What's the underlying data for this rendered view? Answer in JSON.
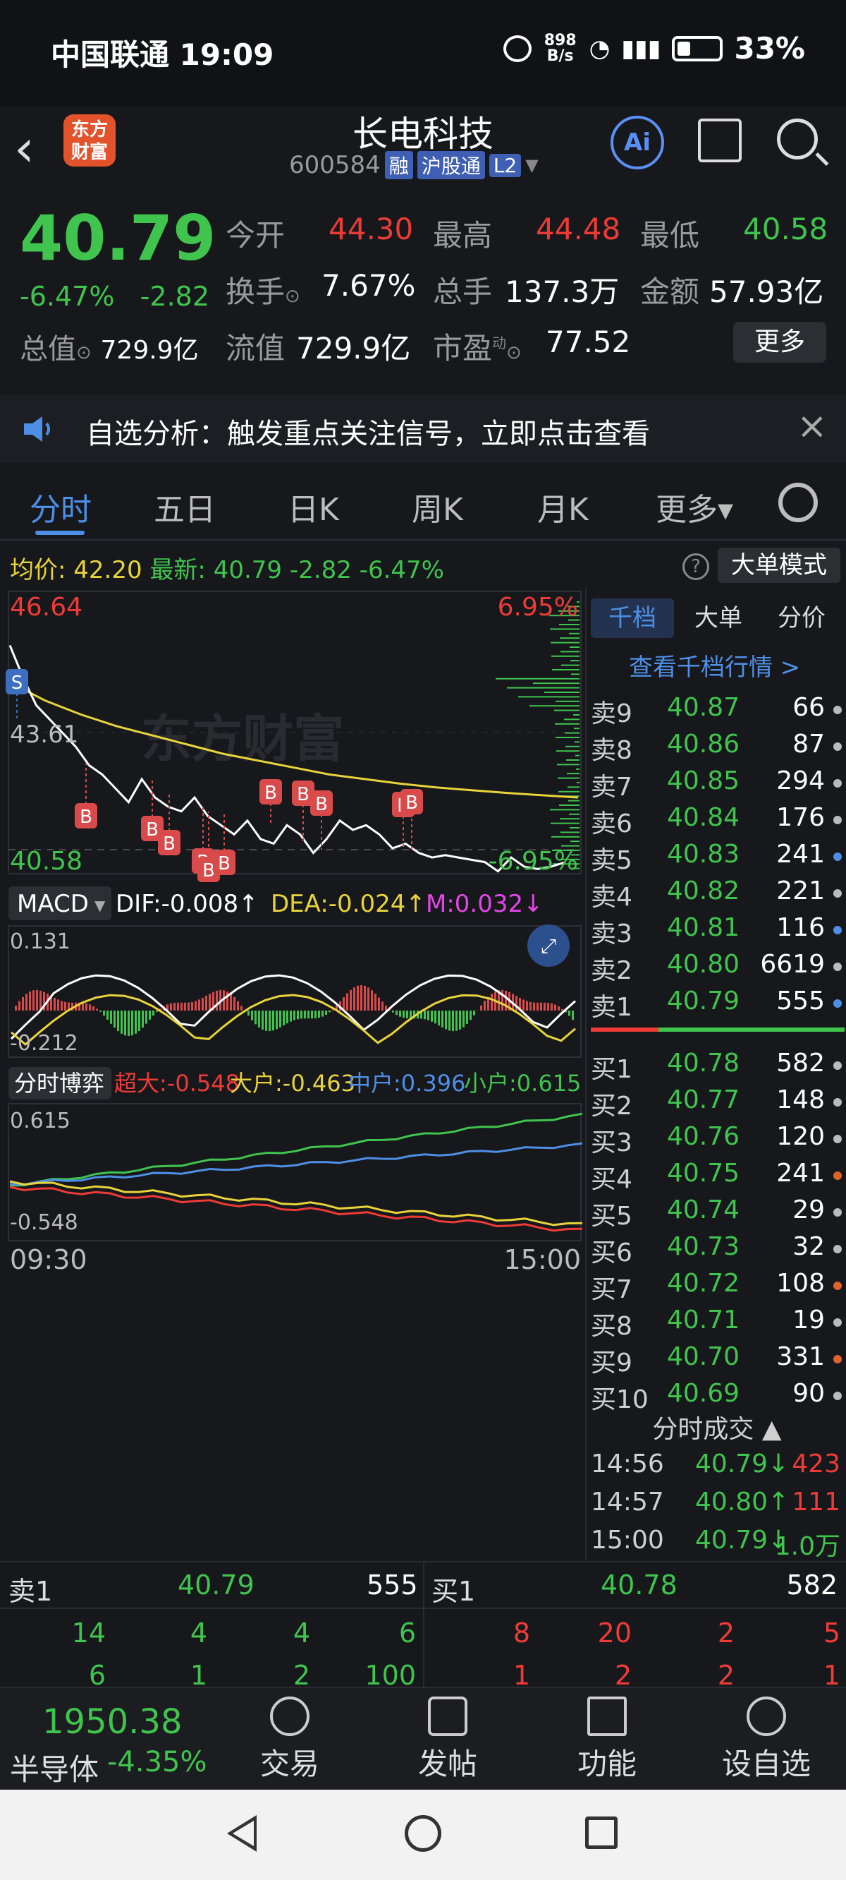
{
  "status_bar": {
    "carrier_time": "中国联通 19:09",
    "net_speed": "898 B/s",
    "battery": "33%"
  },
  "header": {
    "stock_name": "长电科技",
    "code": "600584",
    "tag_margin": "融",
    "tag_hk": "沪股通",
    "tag_level": "L2",
    "logo_text": "东方财富",
    "ai_label": "Ai"
  },
  "quote": {
    "price": "40.79",
    "change_pct": "-6.47%",
    "change": "-2.82",
    "open_label": "今开",
    "open": "44.30",
    "high_label": "最高",
    "high": "44.48",
    "low_label": "最低",
    "low": "40.58",
    "turnover_label": "换手",
    "turnover": "7.67%",
    "volume_label": "总手",
    "volume": "137.3万",
    "amount_label": "金额",
    "amount": "57.93亿",
    "mktcap_label": "总值",
    "mktcap": "729.9亿",
    "float_label": "流值",
    "float": "729.9亿",
    "pe_label": "市盈",
    "pe_sup": "动",
    "pe": "77.52",
    "more_label": "更多"
  },
  "alert": {
    "text": "自选分析：触发重点关注信号，立即点击查看"
  },
  "tabs": [
    "分时",
    "五日",
    "日K",
    "周K",
    "月K",
    "更多▾"
  ],
  "chart_head": {
    "avg_label": "均价:",
    "avg": "42.20",
    "latest_label": "最新:",
    "latest": "40.79",
    "chg": "-2.82",
    "chg_pct": "-6.47%",
    "help": "?",
    "big_mode": "大单模式"
  },
  "chart_data": [
    {
      "type": "line",
      "title": "分时",
      "ylim": [
        40.58,
        46.64
      ],
      "y_labels": {
        "top": "46.64",
        "top_pct": "6.95%",
        "bottom": "40.58",
        "bottom_pct": "-6.95%",
        "prev_close": "43.61"
      },
      "x_labels": [
        "09:30",
        "15:00"
      ],
      "series": [
        {
          "name": "最新",
          "values": [
            45.5,
            44.8,
            44.2,
            43.9,
            43.6,
            43.3,
            42.9,
            42.7,
            42.4,
            42.1,
            42.6,
            42.2,
            42.0,
            41.9,
            42.2,
            41.8,
            41.6,
            41.4,
            41.7,
            41.3,
            41.2,
            41.6,
            41.4,
            41.0,
            41.3,
            41.7,
            41.5,
            41.6,
            41.4,
            41.1,
            41.2,
            41.0,
            40.9,
            40.95,
            40.9,
            40.85,
            40.8,
            40.6,
            40.9,
            40.7,
            40.65,
            40.7,
            40.79
          ]
        },
        {
          "name": "均价",
          "values": [
            44.7,
            44.3,
            44.0,
            43.75,
            43.55,
            43.35,
            43.15,
            43.0,
            42.85,
            42.7,
            42.6,
            42.5,
            42.42,
            42.36,
            42.3,
            42.25,
            42.2
          ]
        }
      ],
      "markers": {
        "S": 1,
        "B": 13
      }
    },
    {
      "type": "bar",
      "title": "MACD",
      "dif": "DIF:-0.008↑",
      "dea": "DEA:-0.024↑",
      "m": "M:0.032↓",
      "ylim": [
        -0.212,
        0.131
      ],
      "y_labels": {
        "top": "0.131",
        "bottom": "-0.212"
      }
    },
    {
      "type": "line",
      "title": "分时博弈",
      "ylim": [
        -0.548,
        0.615
      ],
      "y_labels": {
        "top": "0.615",
        "bottom": "-0.548"
      },
      "series": [
        {
          "name": "超大",
          "value": "-0.548"
        },
        {
          "name": "大户",
          "value": "-0.463"
        },
        {
          "name": "中户",
          "value": "0.396"
        },
        {
          "name": "小户",
          "value": "0.615"
        }
      ]
    }
  ],
  "book": {
    "tabs": [
      "千档",
      "大单",
      "分价"
    ],
    "link": "查看千档行情 >",
    "asks": [
      {
        "label": "卖9",
        "price": "40.87",
        "vol": "66",
        "dot": "#bbbbbb"
      },
      {
        "label": "卖8",
        "price": "40.86",
        "vol": "87",
        "dot": "#bbbbbb"
      },
      {
        "label": "卖7",
        "price": "40.85",
        "vol": "294",
        "dot": "#bbbbbb"
      },
      {
        "label": "卖6",
        "price": "40.84",
        "vol": "176",
        "dot": "#bbbbbb"
      },
      {
        "label": "卖5",
        "price": "40.83",
        "vol": "241",
        "dot": "#4d8fe6"
      },
      {
        "label": "卖4",
        "price": "40.82",
        "vol": "221",
        "dot": "#bbbbbb"
      },
      {
        "label": "卖3",
        "price": "40.81",
        "vol": "116",
        "dot": "#4d8fe6"
      },
      {
        "label": "卖2",
        "price": "40.80",
        "vol": "6619",
        "dot": "#bbbbbb"
      },
      {
        "label": "卖1",
        "price": "40.79",
        "vol": "555",
        "dot": "#4d8fe6"
      }
    ],
    "bids": [
      {
        "label": "买1",
        "price": "40.78",
        "vol": "582",
        "dot": "#bbbbbb"
      },
      {
        "label": "买2",
        "price": "40.77",
        "vol": "148",
        "dot": "#bbbbbb"
      },
      {
        "label": "买3",
        "price": "40.76",
        "vol": "120",
        "dot": "#bbbbbb"
      },
      {
        "label": "买4",
        "price": "40.75",
        "vol": "241",
        "dot": "#e0622d"
      },
      {
        "label": "买5",
        "price": "40.74",
        "vol": "29",
        "dot": "#bbbbbb"
      },
      {
        "label": "买6",
        "price": "40.73",
        "vol": "32",
        "dot": "#bbbbbb"
      },
      {
        "label": "买7",
        "price": "40.72",
        "vol": "108",
        "dot": "#e0622d"
      },
      {
        "label": "买8",
        "price": "40.71",
        "vol": "19",
        "dot": "#bbbbbb"
      },
      {
        "label": "买9",
        "price": "40.70",
        "vol": "331",
        "dot": "#e0622d"
      },
      {
        "label": "买10",
        "price": "40.69",
        "vol": "90",
        "dot": "#bbbbbb"
      }
    ],
    "trade_head": "分时成交 ▲",
    "trades": [
      {
        "time": "14:56",
        "price": "40.79↓",
        "vol": "423",
        "pc": "#3fc44d",
        "vc": "#ee3b36"
      },
      {
        "time": "14:57",
        "price": "40.80↑",
        "vol": "111",
        "pc": "#3fc44d",
        "vc": "#ee3b36"
      },
      {
        "time": "15:00",
        "price": "40.79↓",
        "vol": "1.0万",
        "pc": "#3fc44d",
        "vc": "#3fc44d"
      }
    ]
  },
  "levels": {
    "ask1_label": "卖1",
    "ask1_price": "40.79",
    "ask1_vol": "555",
    "bid1_label": "买1",
    "bid1_price": "40.78",
    "bid1_vol": "582",
    "ask_row1": [
      "14",
      "4",
      "4",
      "6"
    ],
    "ask_row2": [
      "6",
      "1",
      "2",
      "100"
    ],
    "bid_row1": [
      "8",
      "20",
      "2",
      "5"
    ],
    "bid_row2": [
      "1",
      "2",
      "2",
      "1"
    ]
  },
  "bottom": {
    "index_value": "1950.38",
    "index_name": "半导体",
    "index_pct": "-4.35%",
    "trade": "交易",
    "post": "发帖",
    "func": "功能",
    "watch": "设自选"
  },
  "colors": {
    "up": "#ee3b36",
    "down": "#3fc44d",
    "accent": "#4d8fe6",
    "avg": "#e8d43a"
  }
}
